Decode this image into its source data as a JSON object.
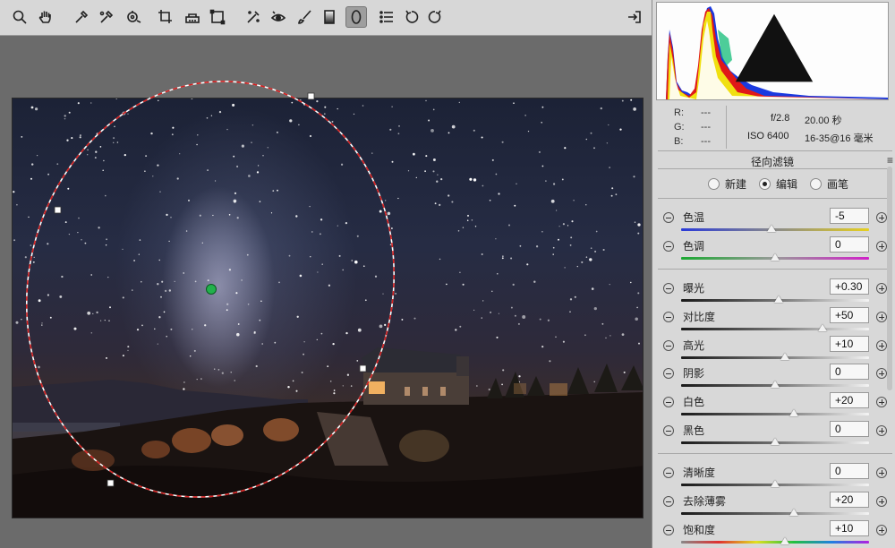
{
  "toolbar": {
    "tools": [
      {
        "id": "zoom",
        "icon": "zoom-icon"
      },
      {
        "id": "hand",
        "icon": "hand-icon"
      },
      {
        "id": "white-balance",
        "icon": "eyedropper-icon"
      },
      {
        "id": "color-sampler",
        "icon": "color-sampler-icon"
      },
      {
        "id": "target-adjust",
        "icon": "target-adjust-icon"
      },
      {
        "id": "crop",
        "icon": "crop-icon"
      },
      {
        "id": "straighten",
        "icon": "straighten-icon"
      },
      {
        "id": "transform",
        "icon": "transform-icon"
      },
      {
        "id": "spot-removal",
        "icon": "spot-removal-icon"
      },
      {
        "id": "red-eye",
        "icon": "red-eye-icon"
      },
      {
        "id": "adjustment-brush",
        "icon": "brush-icon"
      },
      {
        "id": "graduated-filter",
        "icon": "graduated-filter-icon"
      },
      {
        "id": "radial-filter",
        "icon": "radial-filter-icon",
        "active": true
      },
      {
        "id": "preferences",
        "icon": "list-icon"
      },
      {
        "id": "rotate-left",
        "icon": "rotate-left-icon"
      },
      {
        "id": "rotate-right",
        "icon": "rotate-right-icon"
      },
      {
        "id": "toggle-fullscreen",
        "icon": "exit-fullscreen-icon"
      }
    ]
  },
  "info": {
    "r_label": "R:",
    "g_label": "G:",
    "b_label": "B:",
    "r_value": "---",
    "g_value": "---",
    "b_value": "---",
    "aperture": "f/2.8",
    "shutter": "20.00 秒",
    "iso": "ISO 6400",
    "lens": "16-35@16 毫米"
  },
  "panel": {
    "title": "径向滤镜",
    "menu_icon": "≡",
    "modes": [
      {
        "label": "新建",
        "selected": false
      },
      {
        "label": "编辑",
        "selected": true
      },
      {
        "label": "画笔",
        "selected": false
      }
    ]
  },
  "sliders": [
    {
      "label": "色温",
      "value": "-5",
      "position": 0.48,
      "track": "temp"
    },
    {
      "label": "色调",
      "value": "0",
      "position": 0.5,
      "track": "tint"
    },
    {
      "label": "曝光",
      "value": "+0.30",
      "position": 0.52,
      "track": "gray"
    },
    {
      "label": "对比度",
      "value": "+50",
      "position": 0.75,
      "track": "gray"
    },
    {
      "label": "高光",
      "value": "+10",
      "position": 0.55,
      "track": "gray"
    },
    {
      "label": "阴影",
      "value": "0",
      "position": 0.5,
      "track": "gray"
    },
    {
      "label": "白色",
      "value": "+20",
      "position": 0.6,
      "track": "gray"
    },
    {
      "label": "黑色",
      "value": "0",
      "position": 0.5,
      "track": "gray"
    },
    {
      "label": "清晰度",
      "value": "0",
      "position": 0.5,
      "track": "gray"
    },
    {
      "label": "去除薄雾",
      "value": "+20",
      "position": 0.6,
      "track": "gray"
    },
    {
      "label": "饱和度",
      "value": "+10",
      "position": 0.55,
      "track": "sat"
    }
  ],
  "colors": {
    "toolbar_bg": "#d7d7d7",
    "panel_bg": "#d8d8d8",
    "canvas_bg": "#6b6b6b",
    "ellipse_stroke": "#ffffff",
    "ellipse_dash": "#d42020",
    "pin": "#22b14c"
  }
}
